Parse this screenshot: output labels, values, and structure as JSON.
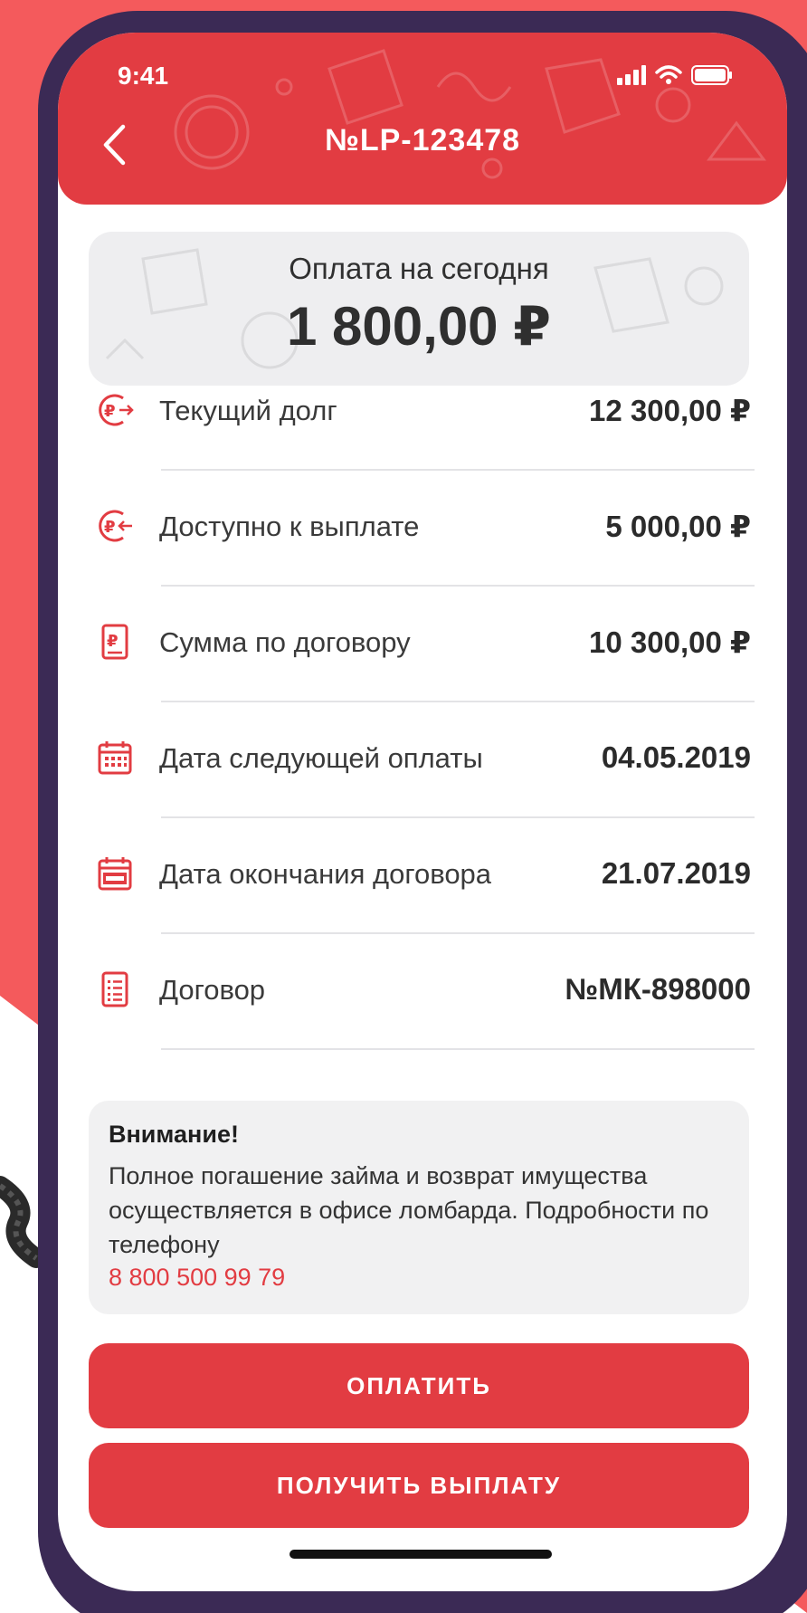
{
  "status_bar": {
    "time": "9:41"
  },
  "nav": {
    "title": "№LP-123478"
  },
  "payment": {
    "label": "Оплата на сегодня",
    "amount": "1 800,00 ₽"
  },
  "rows": [
    {
      "icon": "ruble-out-icon",
      "label": "Текущий долг",
      "value": "12 300,00 ₽"
    },
    {
      "icon": "ruble-in-icon",
      "label": "Доступно к выплате",
      "value": "5 000,00 ₽"
    },
    {
      "icon": "ruble-document-icon",
      "label": "Сумма по договору",
      "value": "10 300,00 ₽"
    },
    {
      "icon": "calendar-icon",
      "label": "Дата следующей оплаты",
      "value": "04.05.2019"
    },
    {
      "icon": "calendar-stop-icon",
      "label": "Дата окончания договора",
      "value": "21.07.2019"
    },
    {
      "icon": "contract-list-icon",
      "label": "Договор",
      "value": "№МК-898000"
    }
  ],
  "notice": {
    "title": "Внимание!",
    "text": "Полное погашение займа и возврат имущества осуществляется в офисе ломбарда. Подробности по телефону",
    "phone": "8 800 500 99 79"
  },
  "buttons": {
    "pay": "ОПЛАТИТЬ",
    "payout": "ПОЛУЧИТЬ ВЫПЛАТУ"
  },
  "colors": {
    "accent": "#e23c42",
    "background_red": "#f45a5c",
    "phone_frame": "#3b2a55",
    "card": "#eeeef0"
  }
}
